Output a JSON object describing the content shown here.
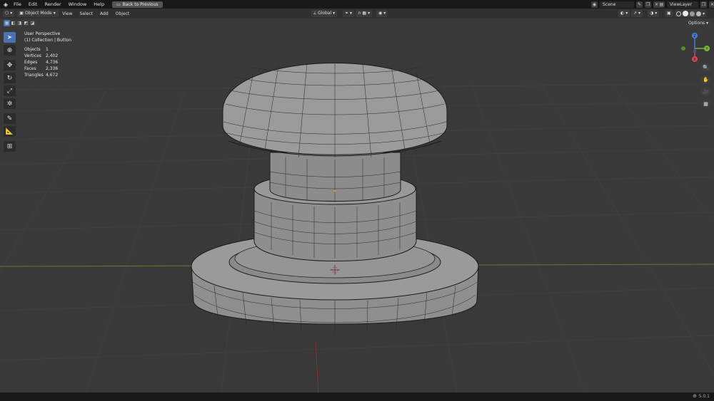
{
  "topbar": {
    "menus": [
      "File",
      "Edit",
      "Render",
      "Window",
      "Help"
    ],
    "back_label": "Back to Previous",
    "scene_label": "Scene",
    "viewlayer_label": "ViewLayer"
  },
  "header": {
    "mode_label": "Object Mode",
    "menus": [
      "View",
      "Select",
      "Add",
      "Object"
    ],
    "transform_orientation": "Global"
  },
  "viewport": {
    "options_label": "Options",
    "overlay": {
      "perspective": "User Perspective",
      "collection": "(1) Collection | Button",
      "stats": [
        {
          "label": "Objects",
          "value": "1"
        },
        {
          "label": "Vertices",
          "value": "2,402"
        },
        {
          "label": "Edges",
          "value": "4,736"
        },
        {
          "label": "Faces",
          "value": "2,336"
        },
        {
          "label": "Triangles",
          "value": "4,672"
        }
      ]
    },
    "gizmo": {
      "x": "X",
      "y": "Y",
      "z": "Z"
    }
  },
  "status": {
    "version": "5.0.1"
  },
  "colors": {
    "x_axis": "#d44755",
    "y_axis": "#7cb530",
    "z_axis": "#3f7ed8",
    "accent": "#4772b3"
  },
  "icons": [
    "blender-logo",
    "select-box-icon",
    "cursor-icon",
    "move-icon",
    "rotate-icon",
    "scale-icon",
    "transform-icon",
    "annotate-icon",
    "measure-icon",
    "add-cube-icon",
    "zoom-icon",
    "hand-icon",
    "camera-icon",
    "grid-icon",
    "globe-icon"
  ]
}
